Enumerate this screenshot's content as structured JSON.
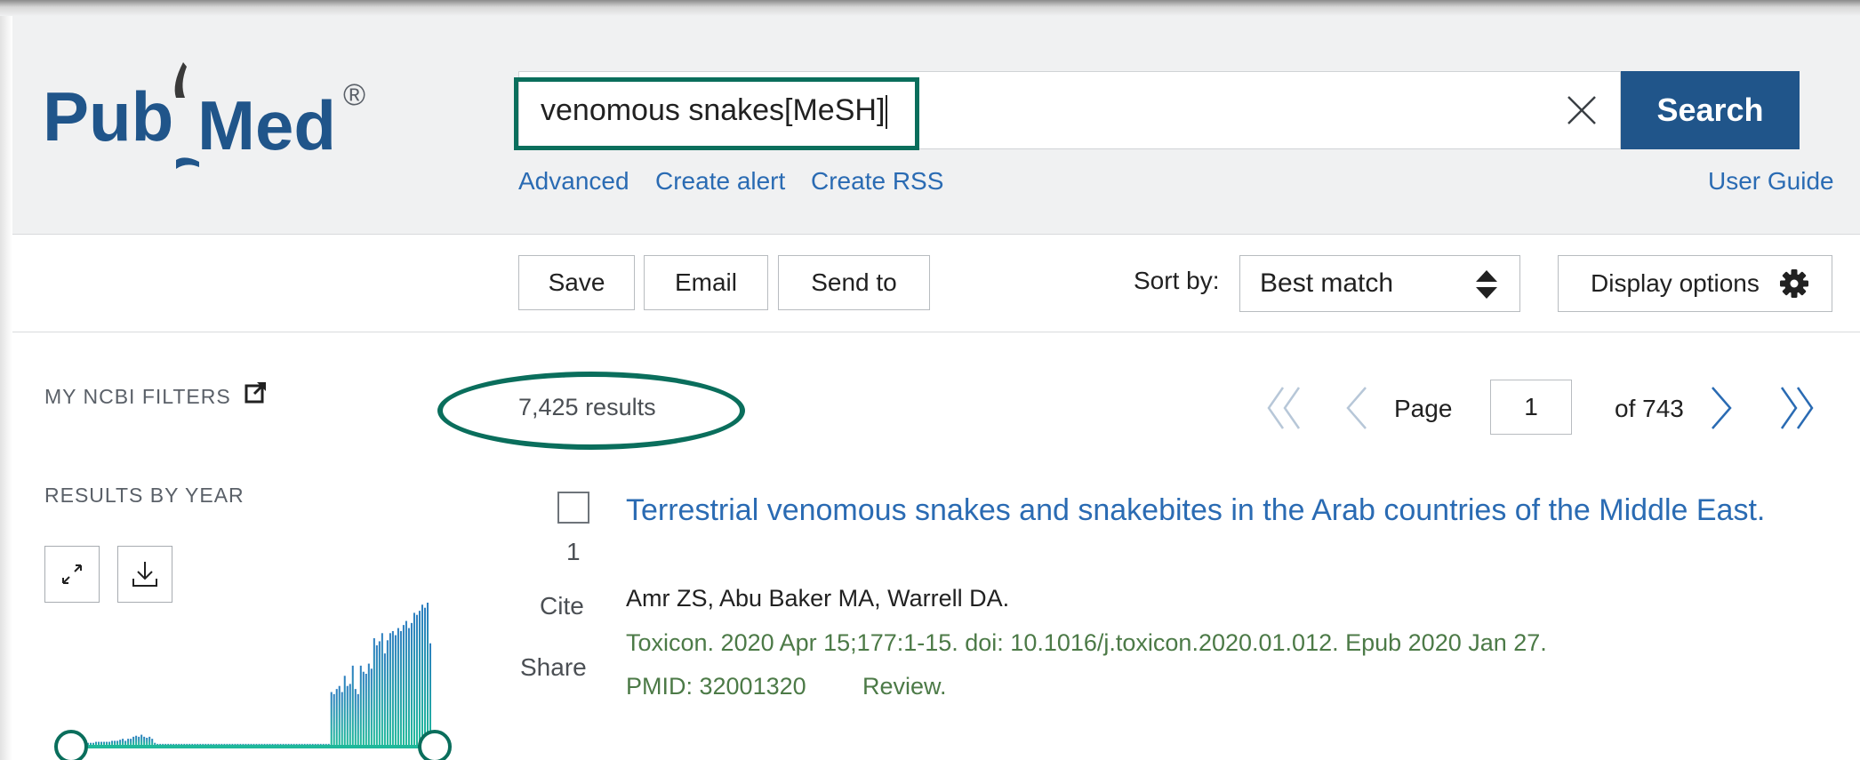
{
  "header": {
    "logo_text_left": "Pub",
    "logo_text_right": "Med",
    "logo_registered": "®",
    "search": {
      "value": "venomous snakes[MeSH]",
      "button_label": "Search"
    },
    "links": {
      "advanced": "Advanced",
      "create_alert": "Create alert",
      "create_rss": "Create RSS",
      "user_guide": "User Guide"
    }
  },
  "toolbar": {
    "save_label": "Save",
    "email_label": "Email",
    "send_to_label": "Send to",
    "sort_by_label": "Sort by:",
    "sort_value": "Best match",
    "display_options_label": "Display options"
  },
  "sidebar": {
    "my_ncbi_filters": "MY NCBI FILTERS",
    "results_by_year": "RESULTS BY YEAR",
    "histogram_values": [
      2,
      2,
      2,
      3,
      3,
      3,
      3,
      3,
      3,
      4,
      4,
      4,
      5,
      6,
      4,
      6,
      6,
      8,
      9,
      8,
      10,
      8,
      7,
      8,
      6,
      2,
      1,
      1,
      1,
      1,
      1,
      1,
      1,
      1,
      1,
      1,
      1,
      1,
      1,
      1,
      1,
      1,
      1,
      1,
      1,
      1,
      1,
      1,
      1,
      1,
      1,
      1,
      1,
      1,
      1,
      1,
      1,
      1,
      1,
      1,
      1,
      1,
      1,
      1,
      1,
      1,
      1,
      1,
      1,
      1,
      1,
      1,
      1,
      1,
      1,
      1,
      1,
      1,
      1,
      1,
      1,
      1,
      1,
      1,
      1,
      1,
      1,
      1,
      1,
      1,
      1,
      52,
      50,
      55,
      58,
      52,
      68,
      58,
      60,
      78,
      55,
      50,
      78,
      72,
      70,
      80,
      75,
      105,
      98,
      102,
      110,
      90,
      103,
      110,
      112,
      108,
      115,
      112,
      118,
      122,
      115,
      120,
      130,
      128,
      132,
      138,
      135,
      140,
      100
    ]
  },
  "results": {
    "count_text": "7,425 results",
    "page_label": "Page",
    "current_page": "1",
    "of_pages": "of 743",
    "items": [
      {
        "number": "1",
        "cite_label": "Cite",
        "share_label": "Share",
        "title": "Terrestrial venomous snakes and snakebites in the Arab countries of the Middle East.",
        "authors": "Amr ZS, Abu Baker MA, Warrell DA.",
        "citation": "Toxicon. 2020 Apr 15;177:1-15. doi: 10.1016/j.toxicon.2020.01.012. Epub 2020 Jan 27.",
        "pmid": "PMID: 32001320",
        "type": "Review."
      }
    ]
  },
  "colors": {
    "brand_blue": "#20558a",
    "link_blue": "#2a6bb3",
    "annotation_green": "#0a6e5c",
    "citation_green": "#4c7a47",
    "histogram_teal": "#1fb89a",
    "histogram_blue": "#2c7ec0"
  },
  "icons": [
    "pubmed-book-icon",
    "clear-x-icon",
    "sort-arrows-icon",
    "gear-icon",
    "external-link-icon",
    "expand-icon",
    "download-icon",
    "first-page-icon",
    "prev-page-icon",
    "next-page-icon",
    "last-page-icon"
  ]
}
